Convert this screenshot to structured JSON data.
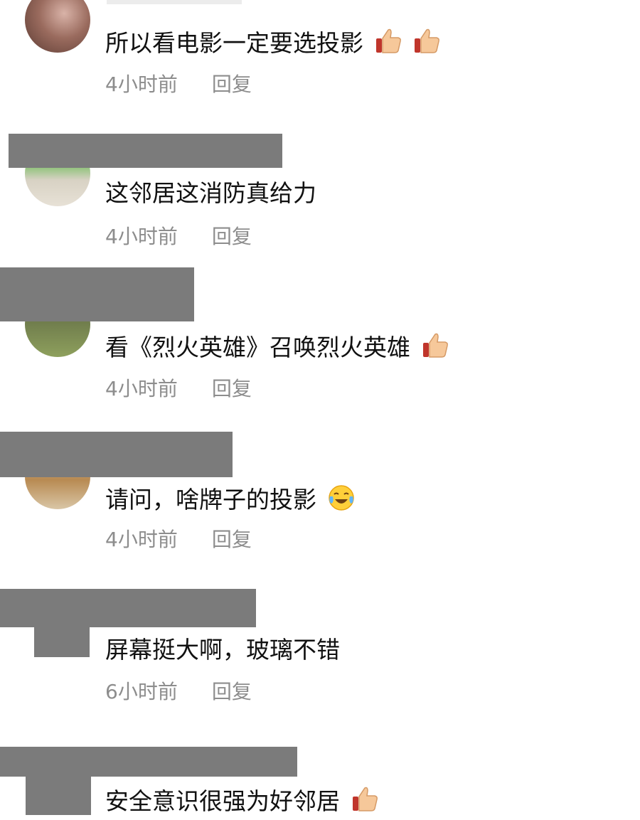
{
  "comments": [
    {
      "text": "所以看电影一定要选投影",
      "emojis": [
        "thumbs-up",
        "thumbs-up"
      ],
      "time": "4小时前",
      "reply": "回复"
    },
    {
      "text": "这邻居这消防真给力",
      "emojis": [],
      "time": "4小时前",
      "reply": "回复"
    },
    {
      "text": "看《烈火英雄》召唤烈火英雄",
      "emojis": [
        "thumbs-up"
      ],
      "time": "4小时前",
      "reply": "回复"
    },
    {
      "text": "请问，啥牌子的投影",
      "emojis": [
        "tears-of-joy"
      ],
      "time": "4小时前",
      "reply": "回复"
    },
    {
      "text": "屏幕挺大啊，玻璃不错",
      "emojis": [],
      "time": "6小时前",
      "reply": "回复"
    },
    {
      "text": "安全意识很强为好邻居",
      "emojis": [
        "thumbs-up"
      ],
      "time": "",
      "reply": ""
    }
  ],
  "colors": {
    "redaction": "#7b7b7b",
    "meta": "#8d8d8d",
    "text": "#111111"
  }
}
